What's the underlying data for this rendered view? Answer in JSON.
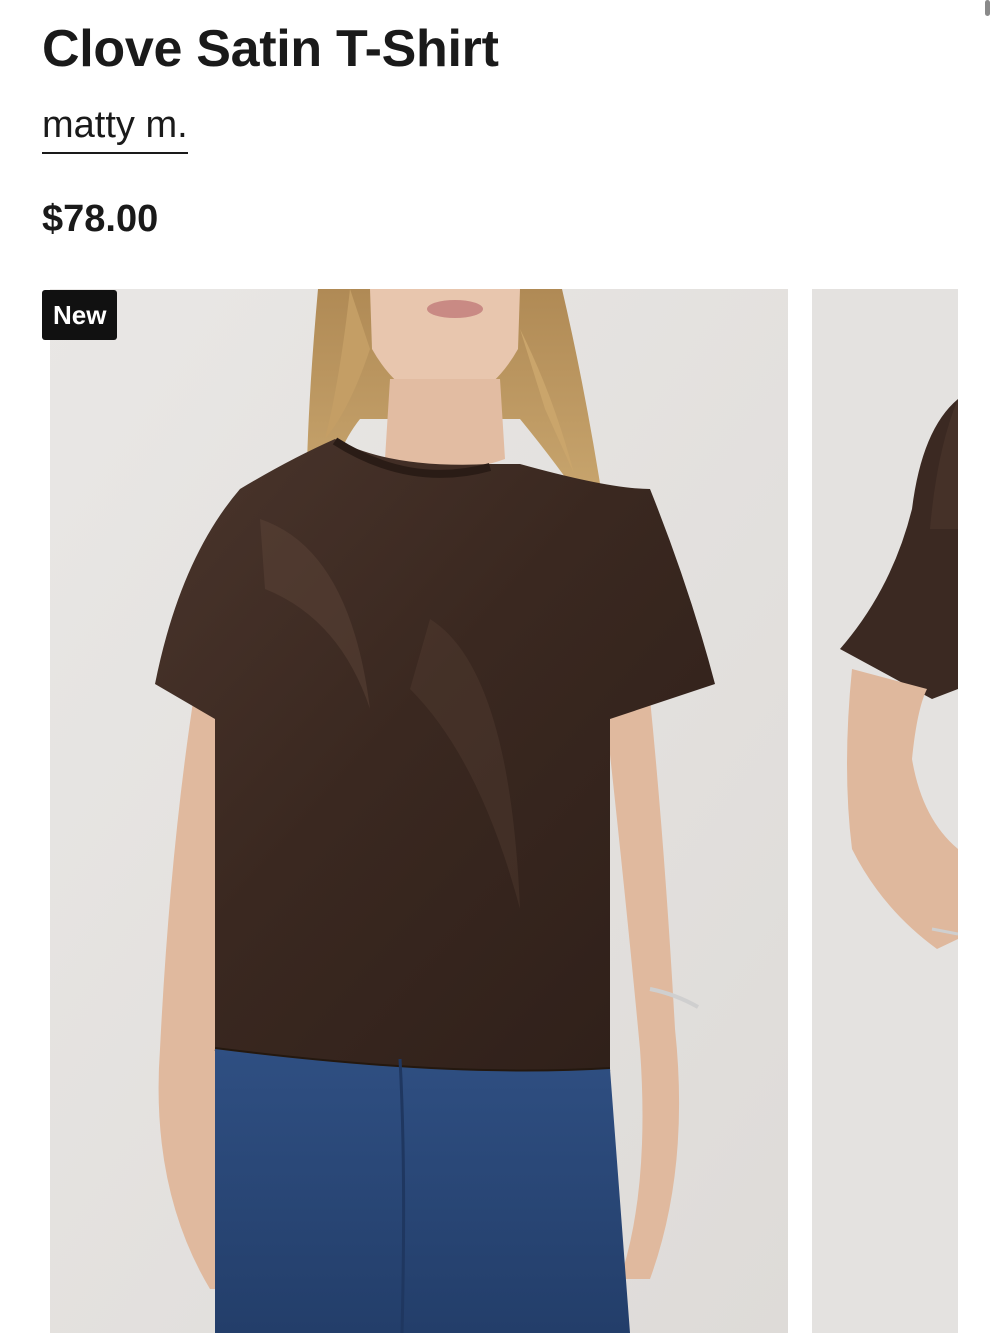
{
  "product": {
    "title": "Clove Satin T-Shirt",
    "brand": "matty m.",
    "price": "$78.00",
    "badge": "New"
  },
  "gallery": {
    "images": [
      {
        "alt": "Model wearing brown satin short-sleeve t-shirt with blue jeans, front view"
      },
      {
        "alt": "Model wearing brown satin short-sleeve t-shirt, side view"
      }
    ]
  },
  "colors": {
    "shirt": "#3d2b23",
    "denim": "#2b4a7c",
    "background": "#e6e4e2",
    "badge": "#111111"
  }
}
